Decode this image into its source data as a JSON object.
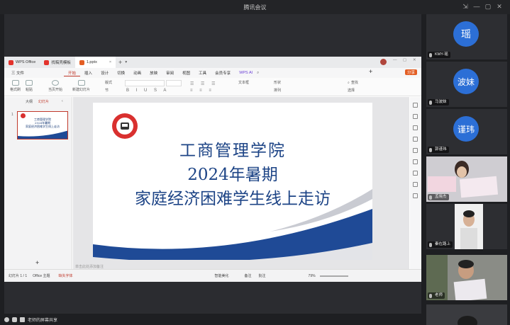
{
  "window": {
    "title": "腾讯会议"
  },
  "wps": {
    "tabs": [
      {
        "label": "WPS Office",
        "color": "#e3332c"
      },
      {
        "label": "找稿壳模板",
        "color": "#e3332c"
      },
      {
        "label": "1.pptx",
        "color": "#e35e24"
      }
    ],
    "menus": [
      "三 文件",
      "开始",
      "插入",
      "设计",
      "切换",
      "动画",
      "放映",
      "审阅",
      "视图",
      "工具",
      "会员专享",
      "WPS AI"
    ],
    "active_menu": "开始",
    "share_label": "分享",
    "toolbar": {
      "format_painter": "格式刷",
      "paste": "粘贴",
      "from_current": "当页开始",
      "new_slide": "新建幻灯片",
      "layout": "版式",
      "section": "节",
      "find": "查找",
      "select": "选择",
      "text_box": "文本框",
      "arrange": "排列",
      "shapes": "形状"
    },
    "left_panel": {
      "tab_outline": "大纲",
      "tab_slides": "幻灯片",
      "slide_number": "1",
      "add_icon": "plus-icon"
    },
    "slide": {
      "line1": "工商管理学院",
      "line2": "2024年暑期",
      "line3": "家庭经济困难学生线上走访",
      "logo_color": "#d9302f",
      "wave_color": "#1f4a96"
    },
    "notes_placeholder": "单击此处添加备注",
    "status": {
      "slide_count": "幻灯片 1 / 1",
      "theme": "Office 主题",
      "font_missing": "缺失字体",
      "smart_beautify": "智能美化",
      "notes": "备注",
      "comments": "批注",
      "zoom": "79%"
    }
  },
  "meeting": {
    "sharing_label": "老师的屏幕共享",
    "participants": [
      {
        "name": "KMY-瑶",
        "avatar_text": "瑶",
        "type": "avatar"
      },
      {
        "name": "马波妹",
        "avatar_text": "波妹",
        "type": "avatar"
      },
      {
        "name": "郭谨玮",
        "avatar_text": "谨玮",
        "type": "avatar"
      },
      {
        "name": "孟晓杰",
        "type": "video"
      },
      {
        "name": "秦在路上",
        "type": "video"
      },
      {
        "name": "老师",
        "type": "video",
        "speaking": true
      },
      {
        "name": "",
        "type": "video"
      }
    ]
  }
}
